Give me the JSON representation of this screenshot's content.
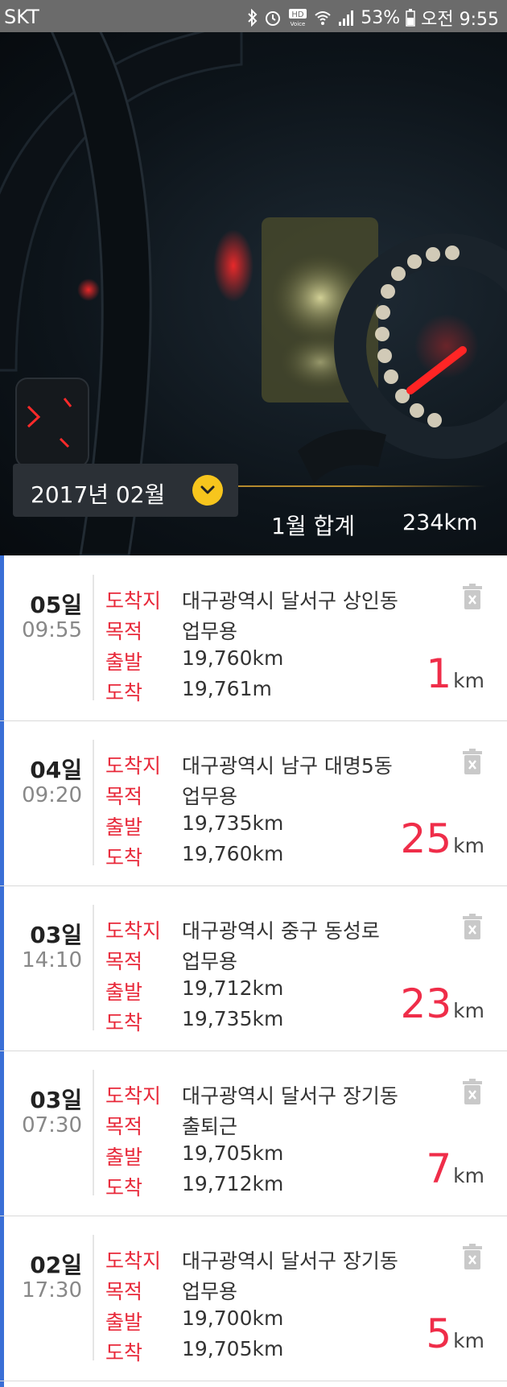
{
  "status": {
    "carrier": "SKT",
    "icons": [
      "bluetooth-icon",
      "alarm-icon",
      "hd-voice-icon",
      "wifi-icon",
      "signal-icon",
      "battery-icon"
    ],
    "battery": "53%",
    "time": "오전 9:55"
  },
  "header": {
    "month_label": "2017년 02월",
    "summary_label": "1월 합계",
    "summary_value": "234km",
    "accent_color": "#f7c51d"
  },
  "labels": {
    "destination": "도착지",
    "purpose": "목적",
    "departure": "출발",
    "arrival": "도착",
    "unit": "km"
  },
  "entries": [
    {
      "day": "05일",
      "time": "09:55",
      "destination": "대구광역시 달서구 상인동",
      "purpose": "업무용",
      "departure": "19,760km",
      "arrival": "19,761m",
      "distance": "1"
    },
    {
      "day": "04일",
      "time": "09:20",
      "destination": "대구광역시 남구 대명5동",
      "purpose": "업무용",
      "departure": "19,735km",
      "arrival": "19,760km",
      "distance": "25"
    },
    {
      "day": "03일",
      "time": "14:10",
      "destination": "대구광역시 중구 동성로",
      "purpose": "업무용",
      "departure": "19,712km",
      "arrival": "19,735km",
      "distance": "23"
    },
    {
      "day": "03일",
      "time": "07:30",
      "destination": "대구광역시 달서구 장기동",
      "purpose": "출퇴근",
      "departure": "19,705km",
      "arrival": "19,712km",
      "distance": "7"
    },
    {
      "day": "02일",
      "time": "17:30",
      "destination": "대구광역시 달서구 장기동",
      "purpose": "업무용",
      "departure": "19,700km",
      "arrival": "19,705km",
      "distance": "5"
    }
  ],
  "colors": {
    "label_red": "#e8293a",
    "distance_red": "#ef2d49",
    "left_accent": "#3a6fd6"
  }
}
